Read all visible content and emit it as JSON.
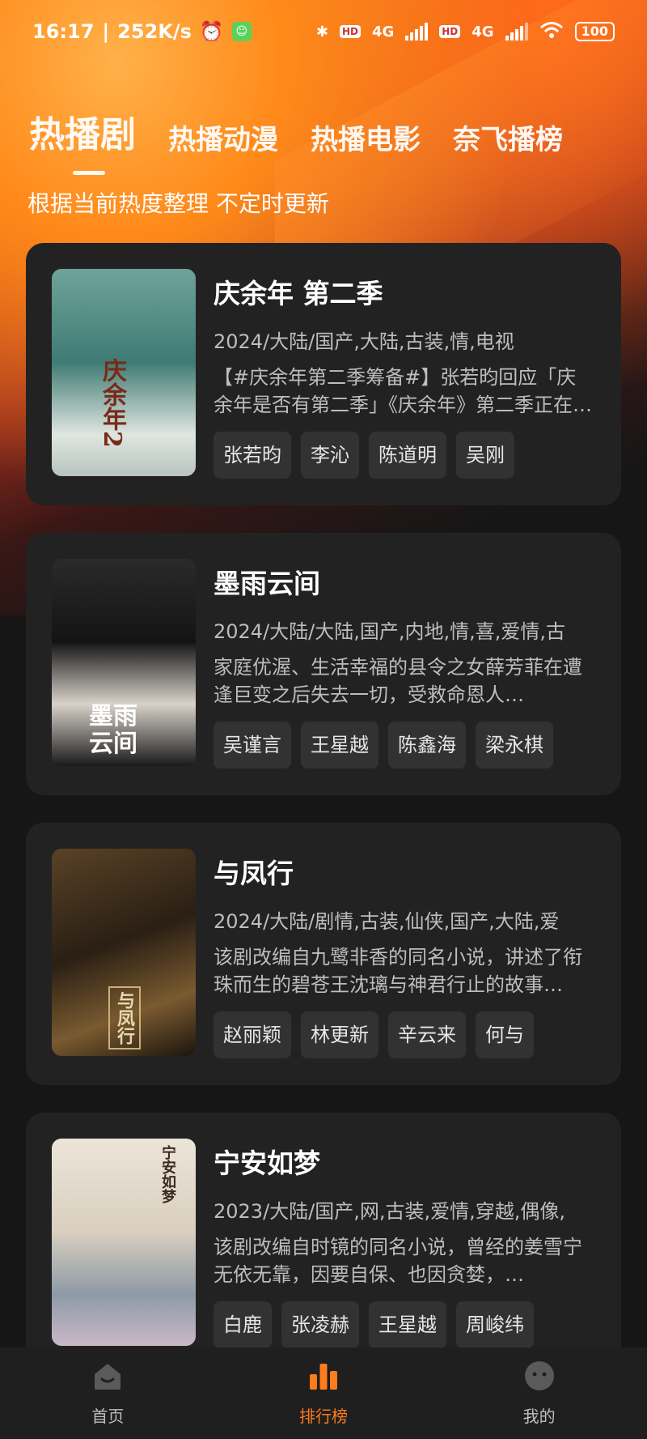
{
  "status_bar": {
    "time": "16:17",
    "net_speed": "252K/s",
    "battery": "100",
    "network_1": "4G",
    "network_2": "4G",
    "hd": "HD"
  },
  "tabs": [
    {
      "label": "热播剧",
      "active": true
    },
    {
      "label": "热播动漫",
      "active": false
    },
    {
      "label": "热播电影",
      "active": false
    },
    {
      "label": "奈飞播榜",
      "active": false
    }
  ],
  "subtitle": "根据当前热度整理 不定时更新",
  "items": [
    {
      "title": "庆余年 第二季",
      "meta": "2024/大陆/国产,大陆,古装,情,电视",
      "desc": "【#庆余年第二季筹备#】张若昀回应「庆余年是否有第二季」《庆余年》第二季正在筹备中…",
      "tags": [
        "张若昀",
        "李沁",
        "陈道明",
        "吴刚"
      ],
      "poster_text": "庆余年2",
      "poster_colors": [
        "#4a8a80",
        "#cfd8d0"
      ]
    },
    {
      "title": "墨雨云间",
      "meta": "2024/大陆/大陆,国产,内地,情,喜,爱情,古",
      "desc": "家庭优渥、生活幸福的县令之女薛芳菲在遭逢巨变之后失去一切，受救命恩人…",
      "tags": [
        "吴谨言",
        "王星越",
        "陈鑫海",
        "梁永棋"
      ],
      "poster_text": "墨雨云间",
      "poster_colors": [
        "#1b1b1b",
        "#e8e2dc"
      ]
    },
    {
      "title": "与凤行",
      "meta": "2024/大陆/剧情,古装,仙侠,国产,大陆,爱",
      "desc": "该剧改编自九鹭非香的同名小说，讲述了衔珠而生的碧苍王沈璃与神君行止的故事…",
      "tags": [
        "赵丽颖",
        "林更新",
        "辛云来",
        "何与"
      ],
      "poster_text": "与凤行",
      "poster_colors": [
        "#3a2a18",
        "#8a6a3a"
      ]
    },
    {
      "title": "宁安如梦",
      "meta": "2023/大陆/国产,网,古装,爱情,穿越,偶像,",
      "desc": "该剧改编自时镜的同名小说，曾经的姜雪宁无依无靠，因要自保、也因贪婪，…",
      "tags": [
        "白鹿",
        "张凌赫",
        "王星越",
        "周峻纬"
      ],
      "poster_text": "宁安如梦",
      "poster_colors": [
        "#e9e1d3",
        "#9aa2a8"
      ]
    }
  ],
  "nav": [
    {
      "label": "首页",
      "icon": "home-icon",
      "active": false
    },
    {
      "label": "排行榜",
      "icon": "chart-bars-icon",
      "active": true
    },
    {
      "label": "我的",
      "icon": "profile-face-icon",
      "active": false
    }
  ],
  "colors": {
    "accent": "#ff7b1c",
    "card": "#222222",
    "tag": "#323232"
  }
}
